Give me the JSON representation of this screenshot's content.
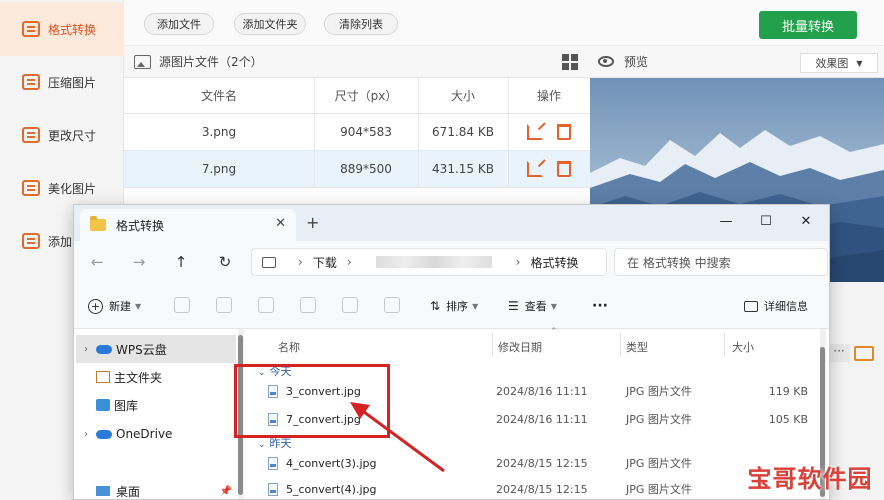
{
  "sidebar": {
    "items": [
      {
        "label": "格式转换",
        "active": true
      },
      {
        "label": "压缩图片"
      },
      {
        "label": "更改尺寸"
      },
      {
        "label": "美化图片"
      },
      {
        "label": "添加"
      }
    ]
  },
  "toolbar": {
    "add_file": "添加文件",
    "add_folder": "添加文件夹",
    "clear_list": "清除列表",
    "batch_convert": "批量转换"
  },
  "source": {
    "title": "源图片文件（2个）",
    "columns": [
      "文件名",
      "尺寸（px）",
      "大小",
      "操作"
    ],
    "rows": [
      {
        "name": "3.png",
        "dims": "904*583",
        "size": "671.84 KB"
      },
      {
        "name": "7.png",
        "dims": "889*500",
        "size": "431.15 KB",
        "selected": true
      }
    ]
  },
  "preview": {
    "title": "预览",
    "mode": "效果图"
  },
  "explorer": {
    "tab_title": "格式转换",
    "breadcrumb": [
      "下载",
      "格式转换"
    ],
    "search_placeholder": "在 格式转换 中搜索",
    "commands": {
      "new": "新建",
      "sort": "排序",
      "view": "查看",
      "more": "···",
      "details": "详细信息"
    },
    "nav": [
      {
        "label": "WPS云盘",
        "selected": true,
        "expand": true
      },
      {
        "label": "主文件夹"
      },
      {
        "label": "图库"
      },
      {
        "label": "OneDrive",
        "expand": true
      },
      {
        "label": "桌面"
      }
    ],
    "columns": [
      "名称",
      "修改日期",
      "类型",
      "大小"
    ],
    "groups": [
      {
        "label": "今天",
        "files": [
          {
            "name": "3_convert.jpg",
            "date": "2024/8/16 11:11",
            "type": "JPG 图片文件",
            "size": "119 KB"
          },
          {
            "name": "7_convert.jpg",
            "date": "2024/8/16 11:11",
            "type": "JPG 图片文件",
            "size": "105 KB"
          }
        ]
      },
      {
        "label": "昨天",
        "files": [
          {
            "name": "4_convert(3).jpg",
            "date": "2024/8/15 12:15",
            "type": "JPG 图片文件",
            "size": ""
          },
          {
            "name": "5_convert(4).jpg",
            "date": "2024/8/15 12:15",
            "type": "JPG 图片文件",
            "size": ""
          }
        ]
      }
    ]
  },
  "watermark": "宝哥软件园",
  "colors": {
    "accent": "#e36a2e",
    "batch_button": "#22a04b",
    "selected_row": "#e9f3fb",
    "annotation_red": "#d32323"
  }
}
